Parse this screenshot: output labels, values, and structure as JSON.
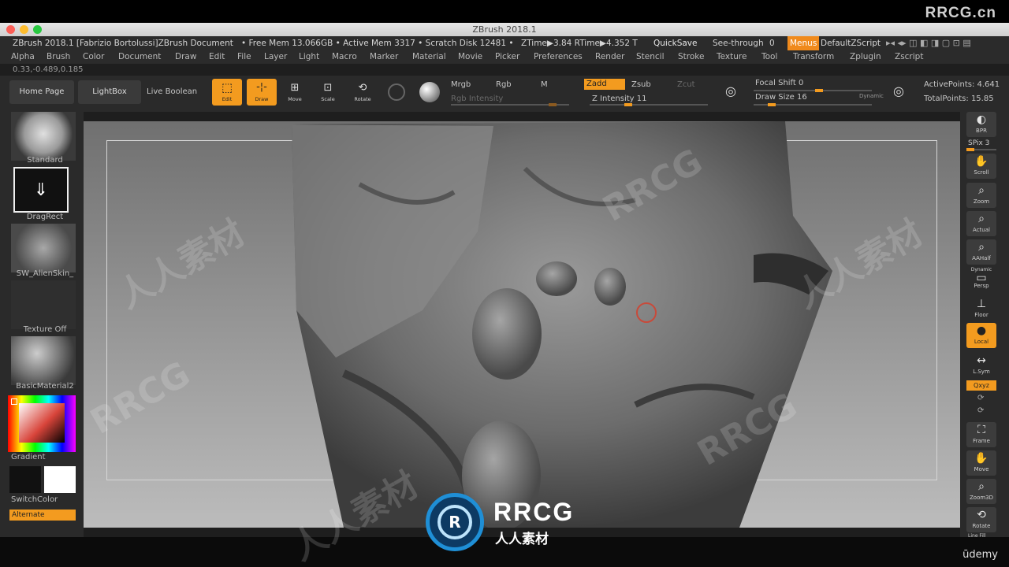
{
  "window": {
    "title": "ZBrush 2018.1",
    "watermark_brand": "RRCG.cn"
  },
  "status": {
    "doc_title": "ZBrush 2018.1 [Fabrizio Bortolussi]ZBrush Document",
    "mem": "• Free Mem 13.066GB • Active Mem 3317 • Scratch Disk 12481 •",
    "ztime": "ZTime▶3.84 RTime▶4.352 T",
    "quicksave": "QuickSave",
    "see_through": "See-through",
    "see_through_val": "0",
    "menus": "Menus",
    "default_script": "DefaultZScript"
  },
  "menubar": {
    "items": [
      "Alpha",
      "Brush",
      "Color",
      "Document",
      "Draw",
      "Edit",
      "File",
      "Layer",
      "Light",
      "Macro",
      "Marker",
      "Material",
      "Movie",
      "Picker",
      "Preferences",
      "Render",
      "Stencil",
      "Stroke",
      "Texture",
      "Tool",
      "Transform",
      "Zplugin",
      "Zscript"
    ]
  },
  "coords": "0.33,-0.489,0.185",
  "shelf": {
    "home_page": "Home Page",
    "lightbox": "LightBox",
    "live_boolean": "Live Boolean",
    "edit": "Edit",
    "draw": "Draw",
    "move": "Move",
    "scale": "Scale",
    "rotate": "Rotate",
    "mrgb": "Mrgb",
    "rgb": "Rgb",
    "m": "M",
    "rgb_intensity": "Rgb Intensity",
    "zadd": "Zadd",
    "zsub": "Zsub",
    "zcut": "Zcut",
    "z_intensity": "Z Intensity 11",
    "focal_shift": "Focal Shift 0",
    "draw_size": "Draw Size 16",
    "dynamic": "Dynamic",
    "active_points": "ActivePoints: 4.641",
    "total_points": "TotalPoints: 15.85"
  },
  "left": {
    "brush": "Standard",
    "stroke": "DragRect",
    "alpha": "SW_AlienSkin_",
    "texture": "Texture Off",
    "material": "BasicMaterial2",
    "gradient": "Gradient",
    "switch_color": "SwitchColor",
    "alternate": "Alternate"
  },
  "right": {
    "bpr": "BPR",
    "spix": "SPix 3",
    "scroll": "Scroll",
    "zoom": "Zoom",
    "actual": "Actual",
    "aahalf": "AAHalf",
    "dynamic": "Dynamic",
    "persp": "Persp",
    "floor": "Floor",
    "local": "Local",
    "lsym": "L.Sym",
    "xyz": "Qxyz",
    "frame": "Frame",
    "move": "Move",
    "zoom3d": "Zoom3D",
    "rotate": "Rotate",
    "line_fill": "Line Fill"
  },
  "footer": {
    "udemy": "ūdemy",
    "logo_top": "RRCG",
    "logo_bottom": "人人素材"
  },
  "watermarks": [
    "RRCG",
    "人人素材"
  ],
  "colors": {
    "accent": "#f39b1f",
    "panel": "#2a2a2a",
    "viewport_top": "#707070",
    "viewport_bottom": "#bcbcbc",
    "logo_blue": "#1f8fd6"
  }
}
